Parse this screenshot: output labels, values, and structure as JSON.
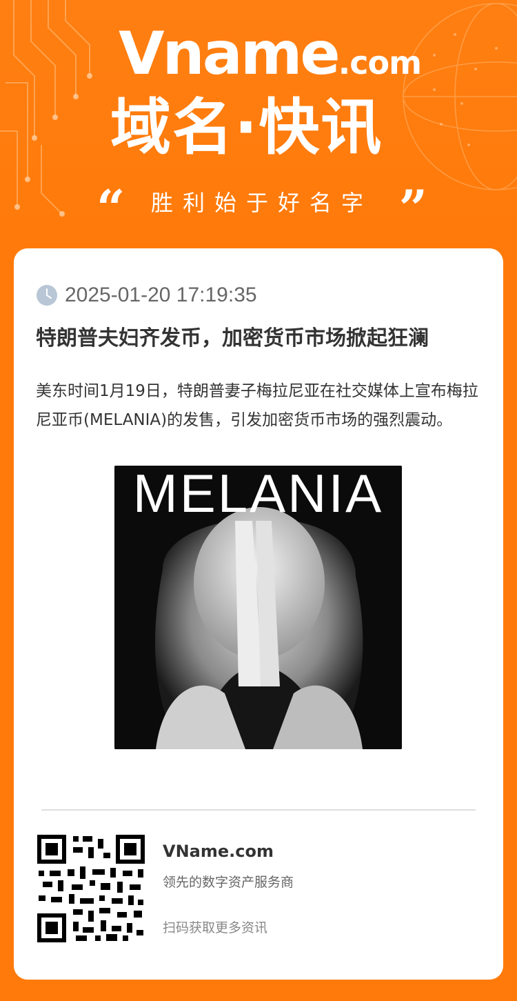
{
  "header": {
    "logo_big": "Vname",
    "logo_small": ".com",
    "headline": "域名·快讯",
    "quote_open": "“",
    "quote_close": "”",
    "slogan": "胜利始于好名字"
  },
  "article": {
    "datetime": "2025-01-20 17:19:35",
    "title": "特朗普夫妇齐发币，加密货币市场掀起狂澜",
    "body": "美东时间1月19日，特朗普妻子梅拉尼亚在社交媒体上宣布梅拉尼亚币(MELANIA)的发售，引发加密货币市场的强烈震动。",
    "image_caption": "MELANIA"
  },
  "footer": {
    "brand": "VName.com",
    "tagline": "领先的数字资产服务商",
    "scan_text": "扫码获取更多资讯"
  },
  "colors": {
    "brand_orange": "#ff7a0a",
    "card_bg": "#ffffff",
    "title_text": "#333333"
  },
  "icons": [
    "clock-icon",
    "qr-code-icon"
  ]
}
